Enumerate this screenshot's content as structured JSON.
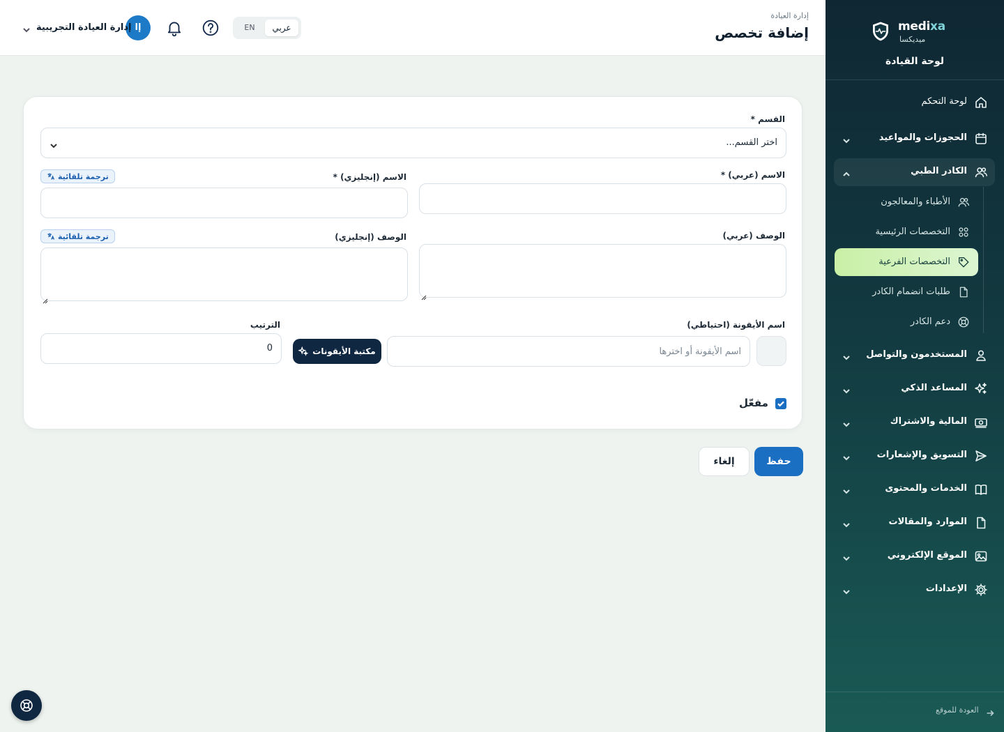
{
  "brand": {
    "name_en_a": "medi",
    "name_en_b": "xa",
    "name_ar": "ميديكسا",
    "panel_title": "لوحة القيادة"
  },
  "sidebar": {
    "items": [
      {
        "label": "لوحة التحكم",
        "icon": "home-icon"
      },
      {
        "label": "الحجوزات والمواعيد",
        "icon": "calendar-icon"
      },
      {
        "label": "الكادر الطبي",
        "icon": "users-icon"
      },
      {
        "label": "المستخدمون والتواصل",
        "icon": "user-icon"
      },
      {
        "label": "المساعد الذكي",
        "icon": "sparkles-icon"
      },
      {
        "label": "المالية والاشتراك",
        "icon": "money-icon"
      },
      {
        "label": "التسويق والإشعارات",
        "icon": "send-icon"
      },
      {
        "label": "الخدمات والمحتوى",
        "icon": "book-icon"
      },
      {
        "label": "الموارد والمقالات",
        "icon": "file-icon"
      },
      {
        "label": "الموقع الإلكتروني",
        "icon": "image-icon"
      },
      {
        "label": "الإعدادات",
        "icon": "gear-icon"
      }
    ],
    "sub_items": [
      {
        "label": "الأطباء والمعالجون",
        "icon": "users-icon"
      },
      {
        "label": "التخصصات الرئيسية",
        "icon": "grid-icon"
      },
      {
        "label": "التخصصات الفرعية",
        "icon": "tag-icon"
      },
      {
        "label": "طلبات انضمام الكادر",
        "icon": "file-icon"
      },
      {
        "label": "دعم الكادر",
        "icon": "lifebuoy-icon"
      }
    ],
    "back_link": "العودة للموقع"
  },
  "header": {
    "breadcrumb": "إدارة العيادة",
    "title": "إضافة تخصص",
    "lang_ar": "عربي",
    "lang_en": "EN",
    "avatar_initials": "إا",
    "user_name": "إدارة العيادة التجريبية"
  },
  "form": {
    "section_label": "القسم *",
    "section_value": "اختر القسم...",
    "name_ar_label": "الاسم (عربي) *",
    "name_en_label": "الاسم (إنجليزي) *",
    "desc_ar_label": "الوصف (عربي)",
    "desc_en_label": "الوصف (إنجليزي)",
    "auto_translate": "ترجمة تلقائية",
    "icon_label": "اسم الأيقونة (احتياطي)",
    "icon_placeholder": "اسم الأيقونة أو اخترها",
    "icon_library": "مكتبة الأيقونات",
    "order_label": "الترتيب",
    "order_value": "0",
    "enabled_label": "مفعّل"
  },
  "actions": {
    "save": "حفظ",
    "cancel": "إلغاء"
  },
  "colors": {
    "primary": "#1b6fc2",
    "sidebar_dark": "#0f2733",
    "active_sub": "#c9f0a6"
  }
}
